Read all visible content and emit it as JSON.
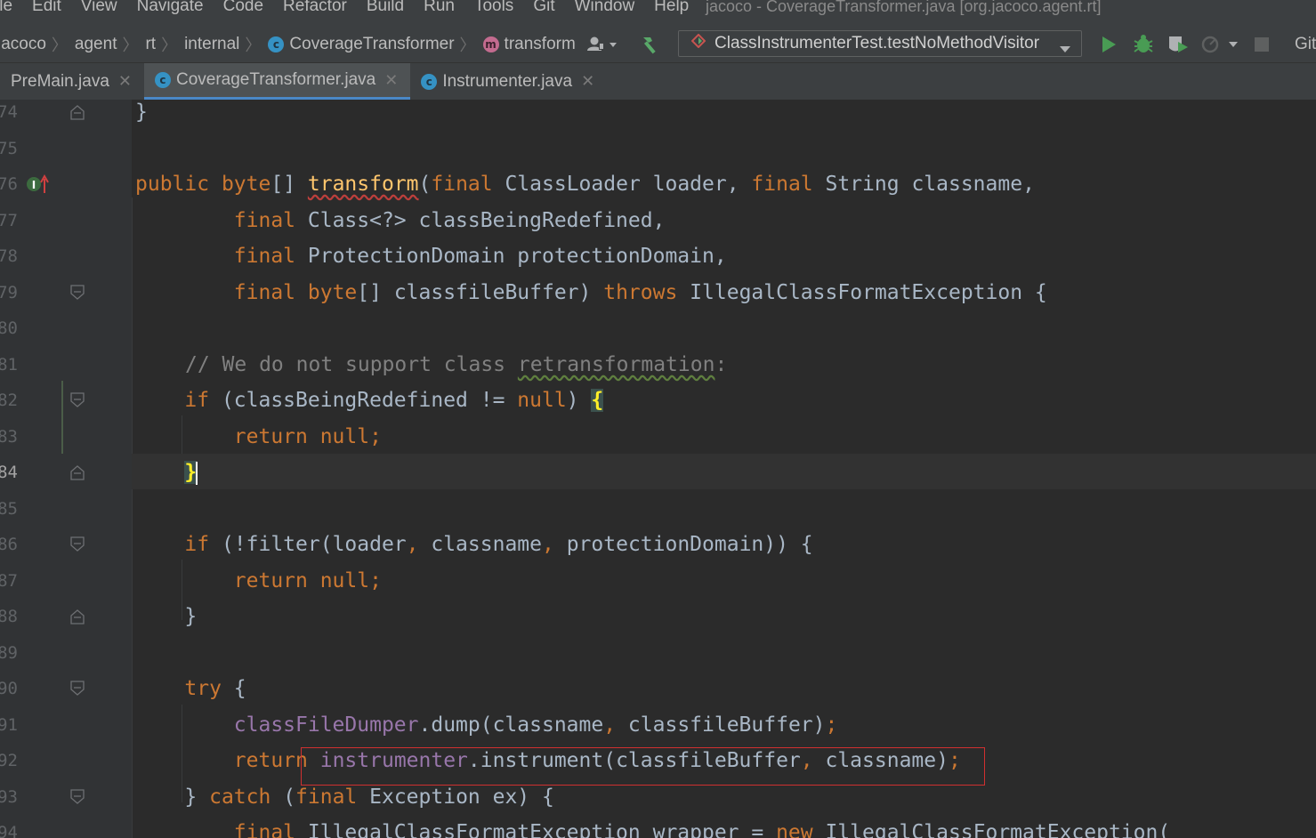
{
  "menubar": {
    "items": [
      "ile",
      "Edit",
      "View",
      "Navigate",
      "Code",
      "Refactor",
      "Build",
      "Run",
      "Tools",
      "Git",
      "Window",
      "Help"
    ],
    "window_title": "jacoco - CoverageTransformer.java [org.jacoco.agent.rt]"
  },
  "navbar": {
    "breadcrumbs": [
      "jacoco",
      "agent",
      "rt",
      "internal",
      "CoverageTransformer",
      "transform"
    ],
    "run_config": "ClassInstrumenterTest.testNoMethodVisitor",
    "git_label": "Git"
  },
  "tabs": [
    {
      "label": "PreMain.java",
      "active": false
    },
    {
      "label": "CoverageTransformer.java",
      "active": true
    },
    {
      "label": "Instrumenter.java",
      "active": false
    }
  ],
  "editor": {
    "current_line": "84",
    "line_numbers": [
      "74",
      "75",
      "76",
      "77",
      "78",
      "79",
      "80",
      "81",
      "82",
      "83",
      "84",
      "85",
      "86",
      "87",
      "88",
      "89",
      "90",
      "91",
      "92",
      "93",
      "94"
    ],
    "comment": "// We do not support class retransformation:"
  },
  "colors": {
    "keyword": "#cc7832",
    "function": "#ffc66d",
    "field": "#9876aa",
    "comment": "#808080",
    "text": "#a9b7c6",
    "highlight_box": "#d03030"
  }
}
